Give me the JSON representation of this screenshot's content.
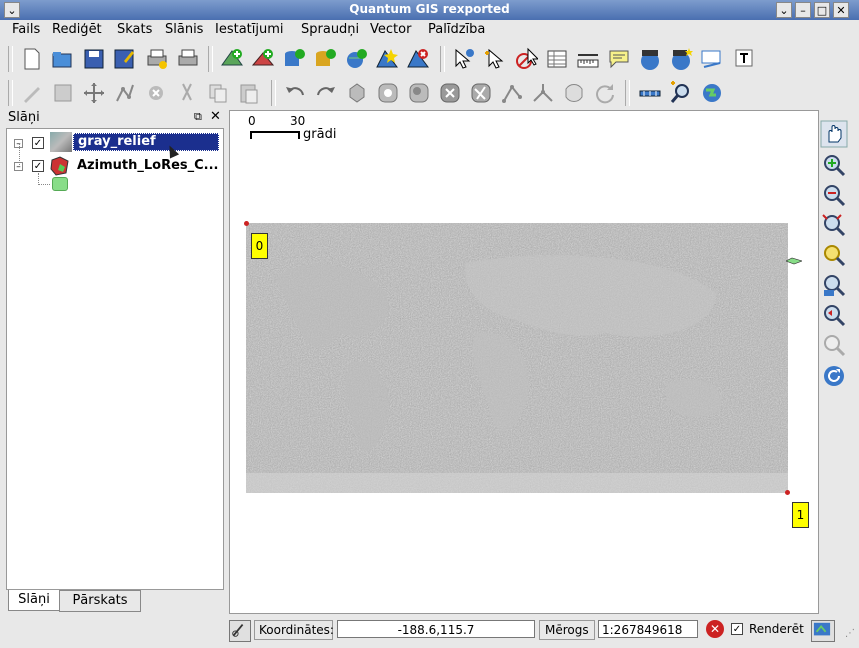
{
  "window": {
    "title": "Quantum GIS rexported"
  },
  "menu": [
    "Fails",
    "Rediģēt",
    "Skats",
    "Slānis",
    "Iestatījumi",
    "Spraudņi",
    "Vector",
    "Palīdzība"
  ],
  "layers_panel": {
    "title": "Slāņi",
    "layers": [
      {
        "name": "gray_relief",
        "checked": true,
        "selected": true
      },
      {
        "name": "Azimuth_LoRes_C...",
        "checked": true,
        "selected": false
      }
    ],
    "tabs": [
      "Slāņi",
      "Pārskats"
    ]
  },
  "map": {
    "scalebar": {
      "start": "0",
      "end": "30",
      "unit": "grādi"
    },
    "labels": [
      "0",
      "1"
    ]
  },
  "status": {
    "coords_label": "Koordinātes:",
    "coords_value": "-188.6,115.7",
    "scale_label": "Mērogs",
    "scale_value": "1:267849618",
    "render_label": "Renderēt",
    "render_checked": true
  }
}
